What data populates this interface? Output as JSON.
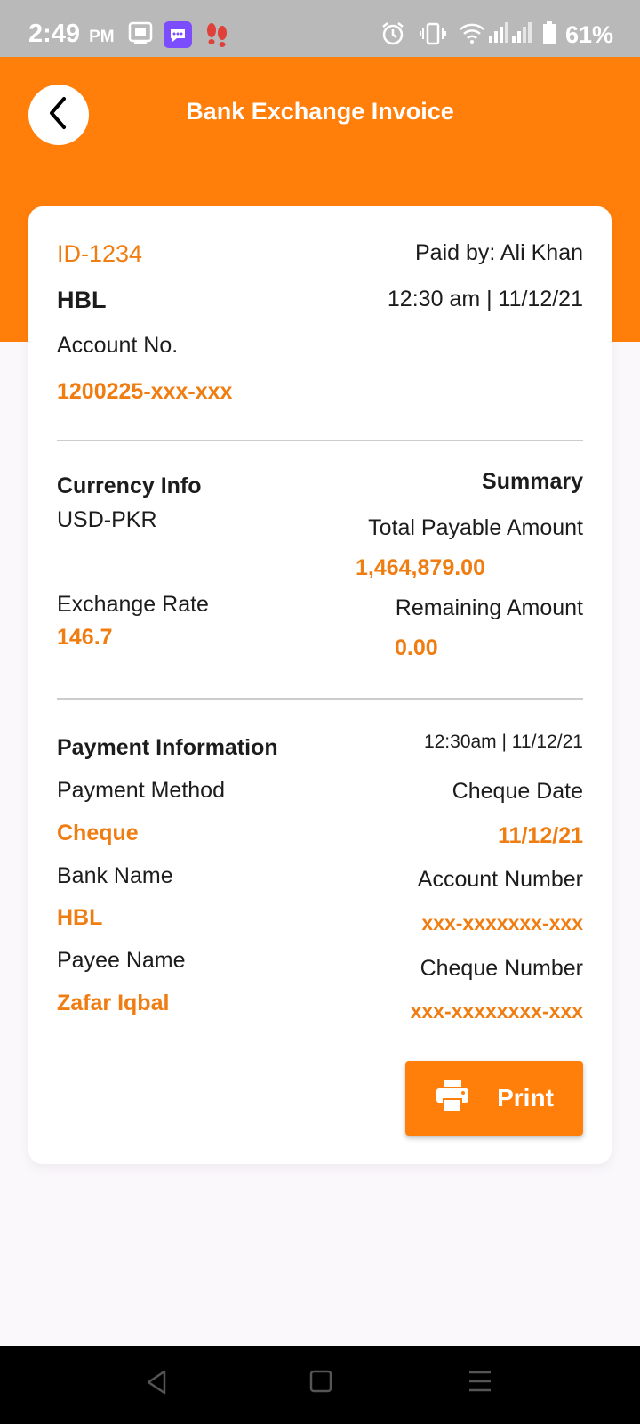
{
  "status_bar": {
    "time": "2:49",
    "ampm": "PM",
    "battery": "61%"
  },
  "header": {
    "title": "Bank Exchange Invoice",
    "accent_color": "#ff7f0a"
  },
  "invoice": {
    "id": "ID-1234",
    "paid_by": "Paid by: Ali Khan",
    "bank": "HBL",
    "datetime": "12:30 am | 11/12/21",
    "account_label": "Account No.",
    "account_value": "1200225-xxx-xxx"
  },
  "currency": {
    "title": "Currency Info",
    "pair": "USD-PKR",
    "rate_label": "Exchange Rate",
    "rate_value": "146.7"
  },
  "summary": {
    "title": "Summary",
    "total_label": "Total Payable Amount",
    "total_value": "1,464,879.00",
    "remaining_label": "Remaining Amount",
    "remaining_value": "0.00"
  },
  "payment": {
    "title": "Payment Information",
    "datetime": "12:30am | 11/12/21",
    "method_label": "Payment Method",
    "method_value": "Cheque",
    "bank_label": "Bank Name",
    "bank_value": "HBL",
    "payee_label": "Payee Name",
    "payee_value": "Zafar Iqbal",
    "cheque_date_label": "Cheque Date",
    "cheque_date_value": "11/12/21",
    "account_number_label": "Account Number",
    "account_number_value": "xxx-xxxxxxx-xxx",
    "cheque_number_label": "Cheque Number",
    "cheque_number_value": "xxx-xxxxxxxx-xxx"
  },
  "actions": {
    "print_label": "Print"
  }
}
